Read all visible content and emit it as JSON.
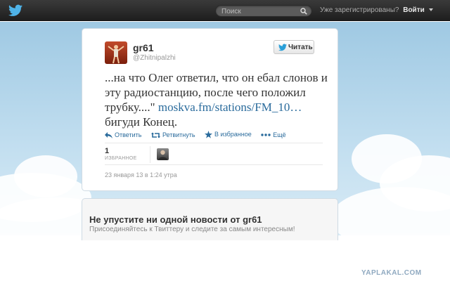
{
  "header": {
    "search_placeholder": "Поиск",
    "login_prompt": "Уже зарегистрированы?",
    "login_link": "Войти"
  },
  "tweet": {
    "user_name": "gr61",
    "user_handle": "@Zhitnipalzhi",
    "follow_label": "Читать",
    "text_before_link": "...на что Олег ответил, что он ебал слонов и эту радиостанцию, после чего положил трубку....\" ",
    "link_text": "moskva.fm/stations/FM_10…",
    "text_after_link": " бигуди Конец.",
    "actions": {
      "reply": "Ответить",
      "retweet": "Ретвитнуть",
      "favorite": "В избранное",
      "more": "Ещё"
    },
    "favorites_count": "1",
    "favorites_label": "ИЗБРАННОЕ",
    "timestamp": "23 января 13 в 1:24 утра"
  },
  "signup": {
    "title": "Не упустите ни одной новости от gr61",
    "subtitle": "Присоединяйтесь к Твиттеру и следите за самым интересным!"
  },
  "watermark": "YAPLAKAL.COM",
  "colors": {
    "accent": "#2a6b9c",
    "topbar": "#2a2a2a",
    "sky": "#b7d8ec"
  }
}
